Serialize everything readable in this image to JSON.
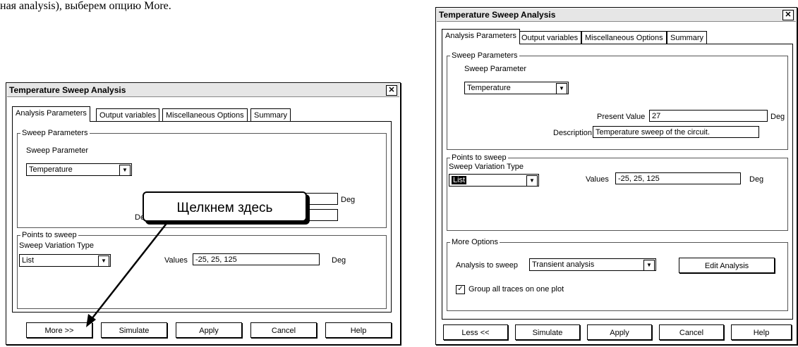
{
  "intro_text": "ная analysis), выберем опцию More.",
  "callout_text": "Щелкнем здесь",
  "left_dialog": {
    "title": "Temperature Sweep Analysis",
    "close_glyph": "✕",
    "tabs": [
      "Analysis Parameters",
      "Output variables",
      "Miscellaneous Options",
      "Summary"
    ],
    "sweep_parameters": {
      "group_label": "Sweep Parameters",
      "param_label": "Sweep Parameter",
      "param_value": "Temperature",
      "unit": "Deg",
      "description_label_fragment": "De"
    },
    "points": {
      "group_label": "Points to sweep",
      "type_label": "Sweep Variation Type",
      "type_value": "List",
      "values_label": "Values",
      "values_value": "-25, 25, 125",
      "unit": "Deg"
    },
    "buttons": [
      "More >>",
      "Simulate",
      "Apply",
      "Cancel",
      "Help"
    ]
  },
  "right_dialog": {
    "title": "Temperature Sweep Analysis",
    "close_glyph": "✕",
    "tabs": [
      "Analysis Parameters",
      "Output variables",
      "Miscellaneous Options",
      "Summary"
    ],
    "sweep_parameters": {
      "group_label": "Sweep Parameters",
      "param_label": "Sweep Parameter",
      "param_value": "Temperature",
      "present_value_label": "Present Value",
      "present_value": "27",
      "unit": "Deg",
      "description_label": "Description",
      "description_value": "Temperature sweep of the circuit."
    },
    "points": {
      "group_label": "Points to sweep",
      "type_label": "Sweep Variation Type",
      "type_value": "List",
      "values_label": "Values",
      "values_value": "-25, 25, 125",
      "unit": "Deg"
    },
    "more_options": {
      "group_label": "More Options",
      "analysis_label": "Analysis to sweep",
      "analysis_value": "Transient analysis",
      "edit_button": "Edit Analysis",
      "group_traces_label": "Group all traces on one plot",
      "group_traces_checked": true
    },
    "buttons": [
      "Less <<",
      "Simulate",
      "Apply",
      "Cancel",
      "Help"
    ]
  }
}
